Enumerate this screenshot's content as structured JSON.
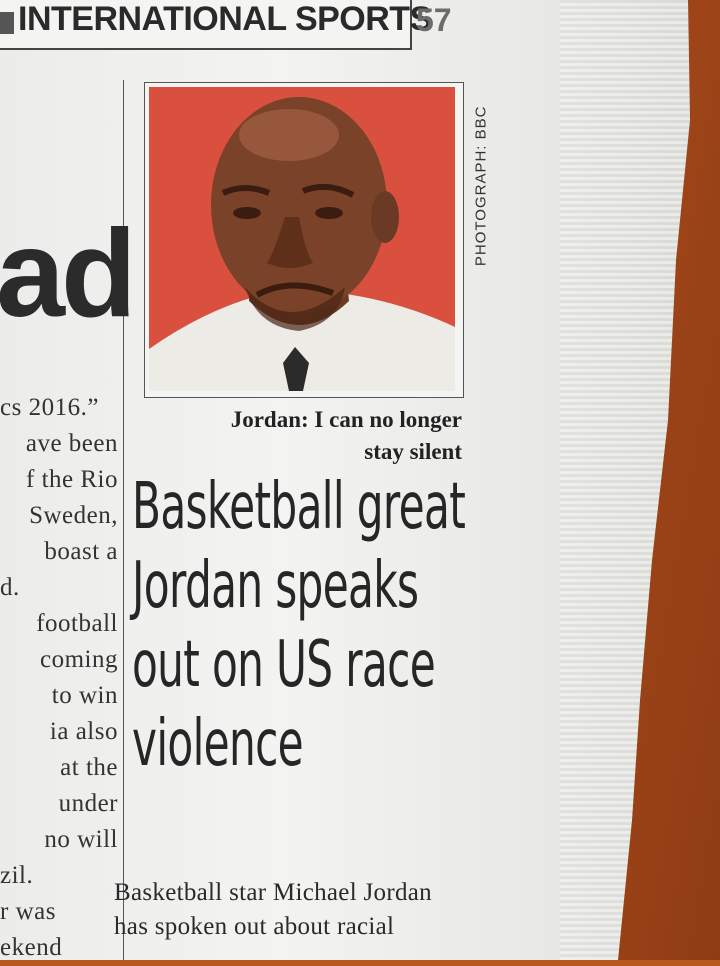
{
  "header": {
    "section_title": "INTERNATIONAL SPORTS",
    "page_number": "57"
  },
  "left_column": {
    "headline_fragment": "ad",
    "lines": [
      "cs 2016.”",
      "ave been",
      "f the Rio",
      "Sweden,",
      "boast a",
      "d.",
      "football",
      "coming",
      "to win",
      "ia also",
      "at the",
      "under",
      "no will",
      "zil.",
      "r was",
      "ekend"
    ]
  },
  "photo": {
    "credit": "PHOTOGRAPH: BBC",
    "caption_line1": "Jordan: I can no longer",
    "caption_line2": "stay silent"
  },
  "article": {
    "headline_lines": [
      "Basketball great",
      "Jordan speaks",
      "out on US race",
      "violence"
    ],
    "body_lines": [
      "Basketball star Michael Jordan",
      "has spoken out about racial"
    ]
  },
  "colors": {
    "photo_background": "#d9503f",
    "table": "#b3531c"
  }
}
